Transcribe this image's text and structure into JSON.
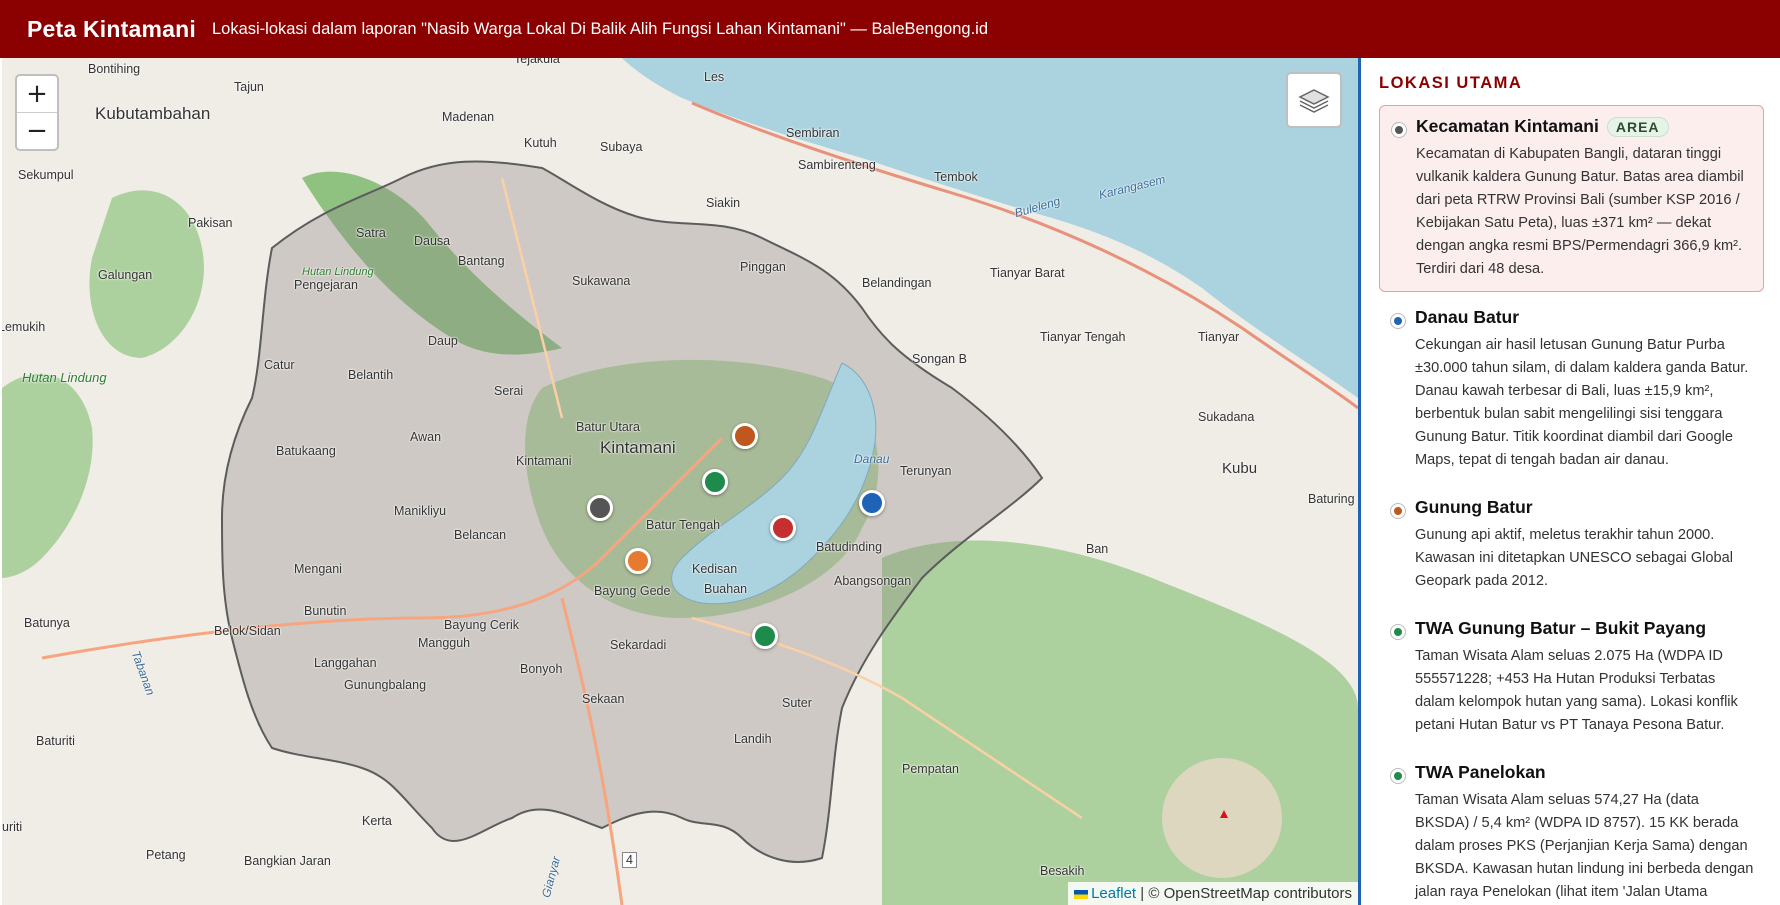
{
  "header": {
    "title": "Peta Kintamani",
    "subtitle": "Lokasi-lokasi dalam laporan \"Nasib Warga Lokal Di Balik Alih Fungsi Lahan Kintamani\" — BaleBengong.id"
  },
  "map": {
    "zoom_in": "+",
    "zoom_out": "−",
    "attribution_leaflet": "Leaflet",
    "attribution_rest": "| © OpenStreetMap contributors",
    "labels": {
      "tejakula": "Tejakula",
      "bontihing": "Bontihing",
      "tajun": "Tajun",
      "les": "Les",
      "kubutambahan": "Kubutambahan",
      "madenan": "Madenan",
      "kutuh": "Kutuh",
      "sembiran": "Sembiran",
      "sekumpul": "Sekumpul",
      "subaya": "Subaya",
      "sambirenteng": "Sambirenteng",
      "tembok": "Tembok",
      "pakisan": "Pakisan",
      "satra": "Satra",
      "dausa": "Dausa",
      "siakin": "Siakin",
      "buleleng": "Buleleng",
      "karangasem": "Karangasem",
      "galungan": "Galungan",
      "bantang": "Bantang",
      "sukawana": "Sukawana",
      "pinggan": "Pinggan",
      "belandingan": "Belandingan",
      "tianyar_barat": "Tianyar Barat",
      "pengejaran": "Pengejaran",
      "lemukih": "Lemukih",
      "daup": "Daup",
      "songan_b": "Songan B",
      "tianyar_tengah": "Tianyar Tengah",
      "tianyar": "Tianyar",
      "catur": "Catur",
      "belantih": "Belantih",
      "serai": "Serai",
      "batur_utara": "Batur Utara",
      "sukadana": "Sukadana",
      "awan": "Awan",
      "kintamani_big": "Kintamani",
      "kintamani": "Kintamani",
      "kubu": "Kubu",
      "batukaang": "Batukaang",
      "terunyan": "Terunyan",
      "baturing": "Baturing",
      "manikliyu": "Manikliyu",
      "batur_tengah": "Batur Tengah",
      "belancan": "Belancan",
      "batudinding": "Batudinding",
      "ban": "Ban",
      "mengani": "Mengani",
      "kedisan": "Kedisan",
      "abangsongan": "Abangsongan",
      "bayung_gede": "Bayung Gede",
      "buahan": "Buahan",
      "bunutin": "Bunutin",
      "batunya": "Batunya",
      "bayung_cerik": "Bayung Cerik",
      "belok_sidan": "Belok/Sidan",
      "mangguh": "Mangguh",
      "langgahan": "Langgahan",
      "sekardadi": "Sekardadi",
      "gunungbalang": "Gunungbalang",
      "bonyoh": "Bonyoh",
      "sekaan": "Sekaan",
      "suter": "Suter",
      "landih": "Landih",
      "pempatan": "Pempatan",
      "baturiti": "Baturiti",
      "kerta": "Kerta",
      "petang": "Petang",
      "bangkian_jaran": "Bangkian Jaran",
      "besakih": "Besakih",
      "uriti": "uriti",
      "hutan_lindung": "Hutan Lindung",
      "hutan_lindung_small": "Hutan Lindung",
      "danau": "Danau",
      "road_4": "4",
      "tabanan": "Tabanan",
      "gianyar": "Gianyar"
    }
  },
  "sidebar": {
    "heading": "LOKASI UTAMA",
    "items": [
      {
        "title": "Kecamatan Kintamani",
        "badge": "AREA",
        "color": "#555555",
        "desc": "Kecamatan di Kabupaten Bangli, dataran tinggi vulkanik kaldera Gunung Batur. Batas area diambil dari peta RTRW Provinsi Bali (sumber KSP 2016 / Kebijakan Satu Peta), luas ±371 km² — dekat dengan angka resmi BPS/Permendagri 366,9 km². Terdiri dari 48 desa."
      },
      {
        "title": "Danau Batur",
        "color": "#1f63b6",
        "desc": "Cekungan air hasil letusan Gunung Batur Purba ±30.000 tahun silam, di dalam kaldera ganda Batur. Danau kawah terbesar di Bali, luas ±15,9 km², berbentuk bulan sabit mengelilingi sisi tenggara Gunung Batur. Titik koordinat diambil dari Google Maps, tepat di tengah badan air danau."
      },
      {
        "title": "Gunung Batur",
        "color": "#c0571f",
        "desc": "Gunung api aktif, meletus terakhir tahun 2000. Kawasan ini ditetapkan UNESCO sebagai Global Geopark pada 2012."
      },
      {
        "title": "TWA Gunung Batur – Bukit Payang",
        "color": "#1e8a4c",
        "desc": "Taman Wisata Alam seluas 2.075 Ha (WDPA ID 555571228; +453 Ha Hutan Produksi Terbatas dalam kelompok hutan yang sama). Lokasi konflik petani Hutan Batur vs PT Tanaya Pesona Batur."
      },
      {
        "title": "TWA Panelokan",
        "color": "#1e8a4c",
        "desc": "Taman Wisata Alam seluas 574,27 Ha (data BKSDA) / 5,4 km² (WDPA ID 8757). 15 KK berada dalam proses PKS (Perjanjian Kerja Sama) dengan BKSDA. Kawasan hutan lindung ini berbeda dengan jalan raya Penelokan (lihat item 'Jalan Utama Panelokan')."
      }
    ]
  },
  "markers": [
    {
      "name": "kintamani-area-marker",
      "color": "#555555"
    },
    {
      "name": "danau-batur-marker",
      "color": "#1f63b6"
    },
    {
      "name": "gunung-batur-marker",
      "color": "#c0571f"
    },
    {
      "name": "twa-bukit-payang-marker",
      "color": "#1e8a4c"
    },
    {
      "name": "twa-panelokan-marker",
      "color": "#1e8a4c"
    },
    {
      "name": "red-marker",
      "color": "#c62f2f"
    },
    {
      "name": "orange-marker",
      "color": "#e67a30"
    }
  ]
}
